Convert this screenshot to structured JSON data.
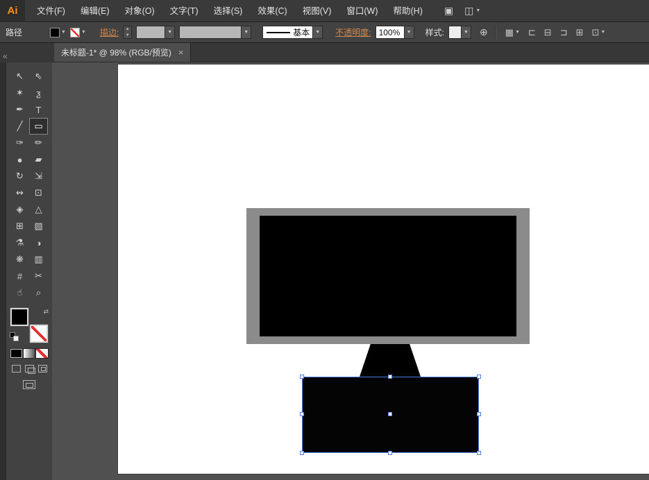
{
  "colors": {
    "selection_blue": "#4b7ce8",
    "monitor_frame_gray": "#8b8b8b",
    "artwork_black": "#000000",
    "link_accent": "#d08850",
    "logo_orange": "#ff9019",
    "artboard_white": "#ffffff"
  },
  "glyphs": {
    "caret": "▼",
    "spinner_up": "▲",
    "swap": "⇄"
  },
  "menubar": {
    "logo": "Ai",
    "items": [
      {
        "name": "menu-file",
        "label": "文件(F)"
      },
      {
        "name": "menu-edit",
        "label": "编辑(E)"
      },
      {
        "name": "menu-object",
        "label": "对象(O)"
      },
      {
        "name": "menu-type",
        "label": "文字(T)"
      },
      {
        "name": "menu-select",
        "label": "选择(S)"
      },
      {
        "name": "menu-effect",
        "label": "效果(C)"
      },
      {
        "name": "menu-view",
        "label": "视图(V)"
      },
      {
        "name": "menu-window",
        "label": "窗口(W)"
      },
      {
        "name": "menu-help",
        "label": "帮助(H)"
      }
    ],
    "bridge_icon": "▣",
    "workspace_icon": "◫"
  },
  "control_bar": {
    "context_label": "路径",
    "stroke_label": "描边:",
    "brush_value": "基本",
    "opacity_label": "不透明度:",
    "opacity_value": "100%",
    "style_label": "样式:",
    "globe_icon": "⊕",
    "right_icons": [
      {
        "name": "arrange-documents-icon",
        "glyph": "▦",
        "dropdown": true
      },
      {
        "name": "align-left-icon",
        "glyph": "⊏",
        "dropdown": false
      },
      {
        "name": "align-center-icon",
        "glyph": "⊟",
        "dropdown": false
      },
      {
        "name": "align-right-icon",
        "glyph": "⊐",
        "dropdown": false
      },
      {
        "name": "distribute-icon",
        "glyph": "⊞",
        "dropdown": false
      },
      {
        "name": "transform-panel-icon",
        "glyph": "⊡",
        "dropdown": true
      }
    ]
  },
  "tabbar": {
    "title": "未标题-1* @ 98% (RGB/预览)",
    "close": "×"
  },
  "toolbar": {
    "collapse_icon": "«",
    "tools": [
      {
        "name": "selection-tool",
        "glyph": "↖",
        "selected": false
      },
      {
        "name": "direct-selection-tool",
        "glyph": "⇖",
        "selected": false
      },
      {
        "name": "magic-wand-tool",
        "glyph": "✶",
        "selected": false
      },
      {
        "name": "lasso-tool",
        "glyph": "ƺ",
        "selected": false
      },
      {
        "name": "pen-tool",
        "glyph": "✒",
        "selected": false
      },
      {
        "name": "type-tool",
        "glyph": "T",
        "selected": false
      },
      {
        "name": "line-segment-tool",
        "glyph": "╱",
        "selected": false
      },
      {
        "name": "rectangle-tool",
        "glyph": "▭",
        "selected": true
      },
      {
        "name": "paintbrush-tool",
        "glyph": "✑",
        "selected": false
      },
      {
        "name": "pencil-tool",
        "glyph": "✏",
        "selected": false
      },
      {
        "name": "blob-brush-tool",
        "glyph": "●",
        "selected": false
      },
      {
        "name": "eraser-tool",
        "glyph": "▰",
        "selected": false
      },
      {
        "name": "rotate-tool",
        "glyph": "↻",
        "selected": false
      },
      {
        "name": "scale-tool",
        "glyph": "⇲",
        "selected": false
      },
      {
        "name": "width-tool",
        "glyph": "↭",
        "selected": false
      },
      {
        "name": "free-transform-tool",
        "glyph": "⊡",
        "selected": false
      },
      {
        "name": "shape-builder-tool",
        "glyph": "◈",
        "selected": false
      },
      {
        "name": "perspective-grid-tool",
        "glyph": "△",
        "selected": false
      },
      {
        "name": "mesh-tool",
        "glyph": "⊞",
        "selected": false
      },
      {
        "name": "gradient-tool",
        "glyph": "▧",
        "selected": false
      },
      {
        "name": "eyedropper-tool",
        "glyph": "⚗",
        "selected": false
      },
      {
        "name": "blend-tool",
        "glyph": "◑",
        "selected": false
      },
      {
        "name": "symbol-sprayer-tool",
        "glyph": "❋",
        "selected": false
      },
      {
        "name": "column-graph-tool",
        "glyph": "▥",
        "selected": false
      },
      {
        "name": "artboard-tool",
        "glyph": "#",
        "selected": false
      },
      {
        "name": "slice-tool",
        "glyph": "✂",
        "selected": false
      },
      {
        "name": "hand-tool",
        "glyph": "☝",
        "selected": false
      },
      {
        "name": "zoom-tool",
        "glyph": "⌕",
        "selected": false
      }
    ]
  },
  "canvas": {
    "artwork": {
      "monitor_frame_color": "#8b8b8b",
      "screen_color": "#000000",
      "stand_color": "#000000",
      "base_color": "#000000",
      "selection_color": "#4b7ce8"
    }
  }
}
